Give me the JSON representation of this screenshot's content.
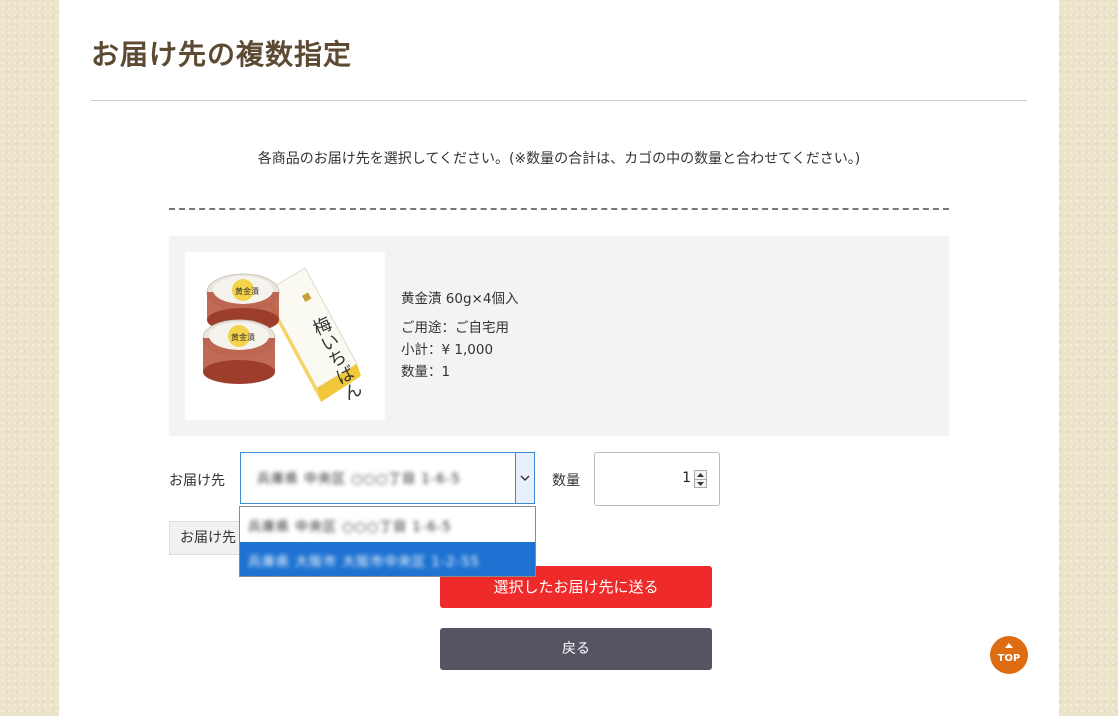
{
  "page": {
    "title": "お届け先の複数指定"
  },
  "instruction": "各商品のお届け先を選択してください。(※数量の合計は、カゴの中の数量と合わせてください。)",
  "product": {
    "name": "黄金漬 60g×4個入",
    "usage": "ご用途：ご自宅用",
    "subtotal": "小計：¥ 1,000",
    "quantity": "数量：1",
    "image_text": {
      "box_script": "梅いちばん",
      "cup_label": "黄金漬"
    }
  },
  "form": {
    "address_label": "お届け先",
    "selected_address": "兵庫県 中央区 ○○○丁目 1-6-5",
    "quantity_label": "数量",
    "quantity_value": "1",
    "add_button_label": "お届け先"
  },
  "dropdown": {
    "options": [
      "兵庫県 中央区 ○○○丁目 1-6-5",
      "兵庫県 大阪市 大阪市中央区 1-2-55"
    ],
    "highlighted_index": 1
  },
  "buttons": {
    "send": "選択したお届け先に送る",
    "back": "戻る",
    "top": "TOP"
  },
  "colors": {
    "title": "#5c4a33",
    "send_button": "#ef2a2a",
    "back_button": "#565463",
    "top_button": "#dd6c12",
    "highlight": "#1e73d2"
  }
}
